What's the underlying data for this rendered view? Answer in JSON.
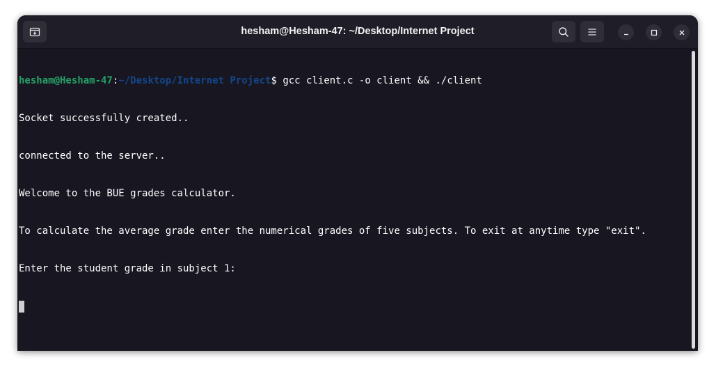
{
  "window": {
    "title": "hesham@Hesham-47: ~/Desktop/Internet Project"
  },
  "icons": {
    "new_tab": "new-tab-icon",
    "search": "search-icon",
    "menu": "hamburger-menu-icon",
    "minimize": "minimize-icon",
    "maximize": "maximize-icon",
    "close": "close-icon"
  },
  "terminal": {
    "prompt": {
      "user_host": "hesham@Hesham-47",
      "colon": ":",
      "path": "~/Desktop/Internet Project",
      "symbol": "$ ",
      "command": "gcc client.c -o client && ./client"
    },
    "output": [
      "Socket successfully created..",
      "connected to the server..",
      "Welcome to the BUE grades calculator.",
      "To calculate the average grade enter the numerical grades of five subjects. To exit at anytime type \"exit\".",
      "Enter the student grade in subject 1:"
    ]
  },
  "colors": {
    "terminal_bg": "#181621",
    "titlebar_bg": "#1f1e28",
    "prompt_user": "#26a269",
    "prompt_path": "#12488b",
    "text": "#ffffff"
  }
}
